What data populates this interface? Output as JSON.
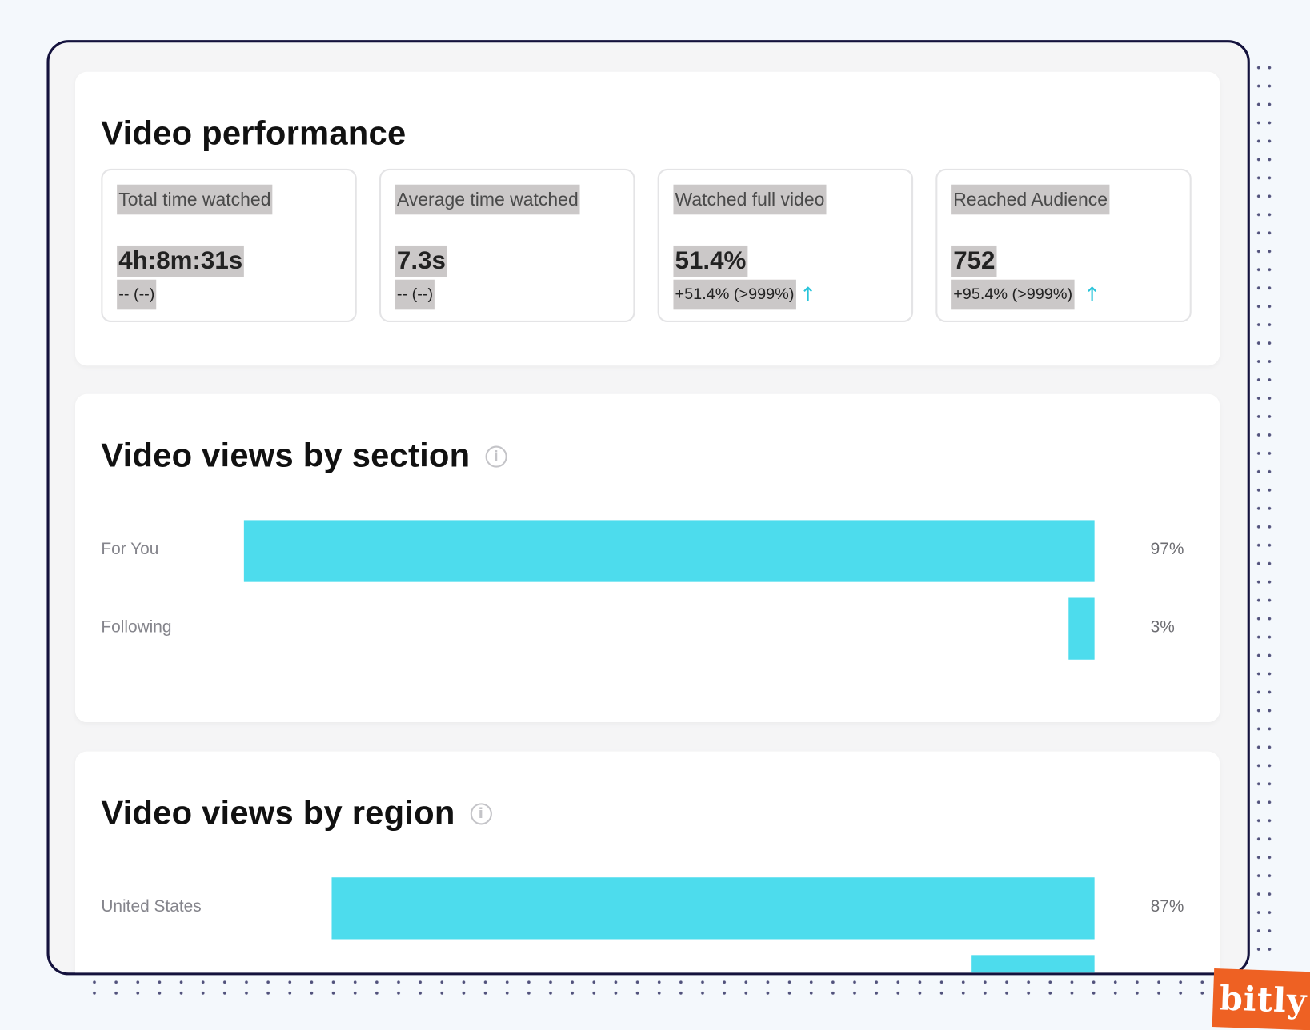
{
  "performance": {
    "title": "Video performance",
    "metrics": [
      {
        "label": "Total time watched",
        "value": "4h:8m:31s",
        "change": "-- (--)",
        "trend": null
      },
      {
        "label": "Average time watched",
        "value": "7.3s",
        "change": "-- (--)",
        "trend": null
      },
      {
        "label": "Watched full video",
        "value": "51.4%",
        "change": "+51.4% (>999%)",
        "trend": "arrow-up-icon"
      },
      {
        "label": "Reached Audience",
        "value": "752",
        "change": "+95.4% (>999%)",
        "trend": "arrow-up-icon"
      }
    ]
  },
  "by_section": {
    "title": "Video views by section",
    "rows": [
      {
        "label": "For You",
        "value": 97,
        "display": "97%"
      },
      {
        "label": "Following",
        "value": 3,
        "display": "3%"
      }
    ]
  },
  "by_region": {
    "title": "Video views by region",
    "rows": [
      {
        "label": "United States",
        "value": 87,
        "display": "87%"
      },
      {
        "label": "",
        "value": 14,
        "display": ""
      }
    ]
  },
  "colors": {
    "bar": "#4ddced",
    "trend_up": "#29c4da",
    "brand": "#ee6123"
  },
  "brand": {
    "logo_text": "bitly"
  }
}
